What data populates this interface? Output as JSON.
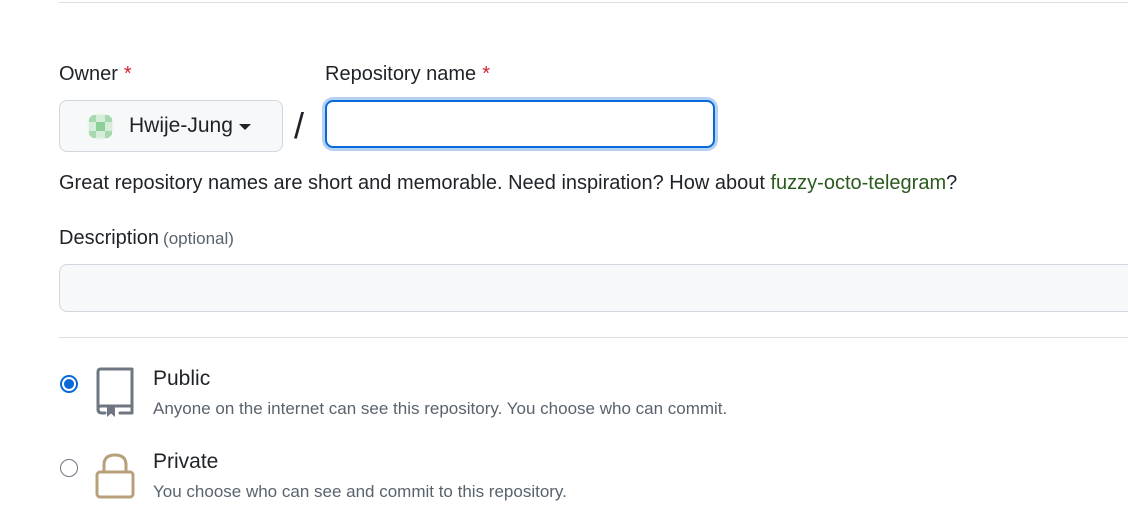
{
  "owner": {
    "label": "Owner",
    "required_mark": "*",
    "selected": "Hwije-Jung"
  },
  "repository_name": {
    "label": "Repository name",
    "required_mark": "*",
    "value": "",
    "separator": "/"
  },
  "name_hint": {
    "text": "Great repository names are short and memorable. Need inspiration? How about ",
    "suggestion": "fuzzy-octo-telegram",
    "suffix": "?"
  },
  "description": {
    "label": "Description",
    "optional_label": "(optional)",
    "value": ""
  },
  "visibility": {
    "selected": "public",
    "options": [
      {
        "id": "public",
        "title": "Public",
        "description": "Anyone on the internet can see this repository. You choose who can commit.",
        "icon": "repo-icon"
      },
      {
        "id": "private",
        "title": "Private",
        "description": "You choose who can see and commit to this repository.",
        "icon": "lock-icon"
      }
    ]
  },
  "colors": {
    "accent": "#0969da",
    "required": "#cf222e",
    "suggestion": "#2a5a1d",
    "private_icon": "#b8a07a"
  }
}
